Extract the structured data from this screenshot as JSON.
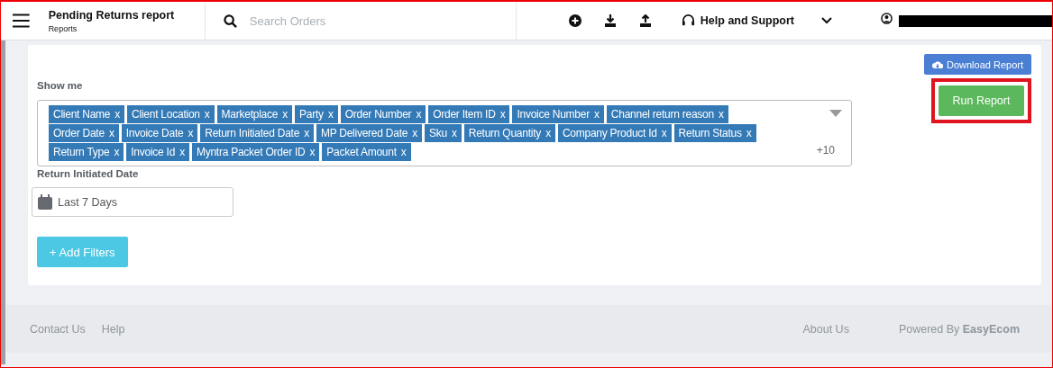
{
  "header": {
    "title": "Pending Returns report",
    "subtitle": "Reports",
    "search": {
      "placeholder": "Search Orders"
    },
    "help": "Help and Support"
  },
  "download_button": "Download Report",
  "show_me": {
    "label": "Show me",
    "tag_rows": [
      [
        {
          "label": "Client Name",
          "remove": "x"
        },
        {
          "label": "Client Location",
          "remove": "x"
        },
        {
          "label": "Marketplace",
          "remove": "x"
        },
        {
          "label": "Party",
          "remove": "x"
        },
        {
          "label": "Order Number",
          "remove": "x"
        },
        {
          "label": "Order Item ID",
          "remove": "x"
        },
        {
          "label": "Invoice Number",
          "remove": "x"
        },
        {
          "label": "Channel return reason",
          "remove": "x"
        }
      ],
      [
        {
          "label": "Order Date",
          "remove": "x"
        },
        {
          "label": "Invoice Date",
          "remove": "x"
        },
        {
          "label": "Return Initiated Date",
          "remove": "x"
        },
        {
          "label": "MP Delivered Date",
          "remove": "x"
        },
        {
          "label": "Sku",
          "remove": "x"
        },
        {
          "label": "Return Quantity",
          "remove": "x"
        },
        {
          "label": "Company Product Id",
          "remove": "x"
        },
        {
          "label": "Return Status",
          "remove": "x"
        }
      ],
      [
        {
          "label": "Return Type",
          "remove": "x"
        },
        {
          "label": "Invoice Id",
          "remove": "x"
        },
        {
          "label": "Myntra Packet Order ID",
          "remove": "x"
        },
        {
          "label": "Packet Amount",
          "remove": "x"
        }
      ]
    ],
    "more": "+10"
  },
  "run_button": {
    "label": "Run Report",
    "highlighted": true
  },
  "date_filter": {
    "label": "Return Initiated Date",
    "value": "Last 7 Days"
  },
  "add_filters_button": "+ Add Filters",
  "footer": {
    "left_links": [
      "Contact Us",
      "Help"
    ],
    "right_links": [
      "About Us"
    ],
    "powered": "Powered By **EasyEcom**"
  }
}
